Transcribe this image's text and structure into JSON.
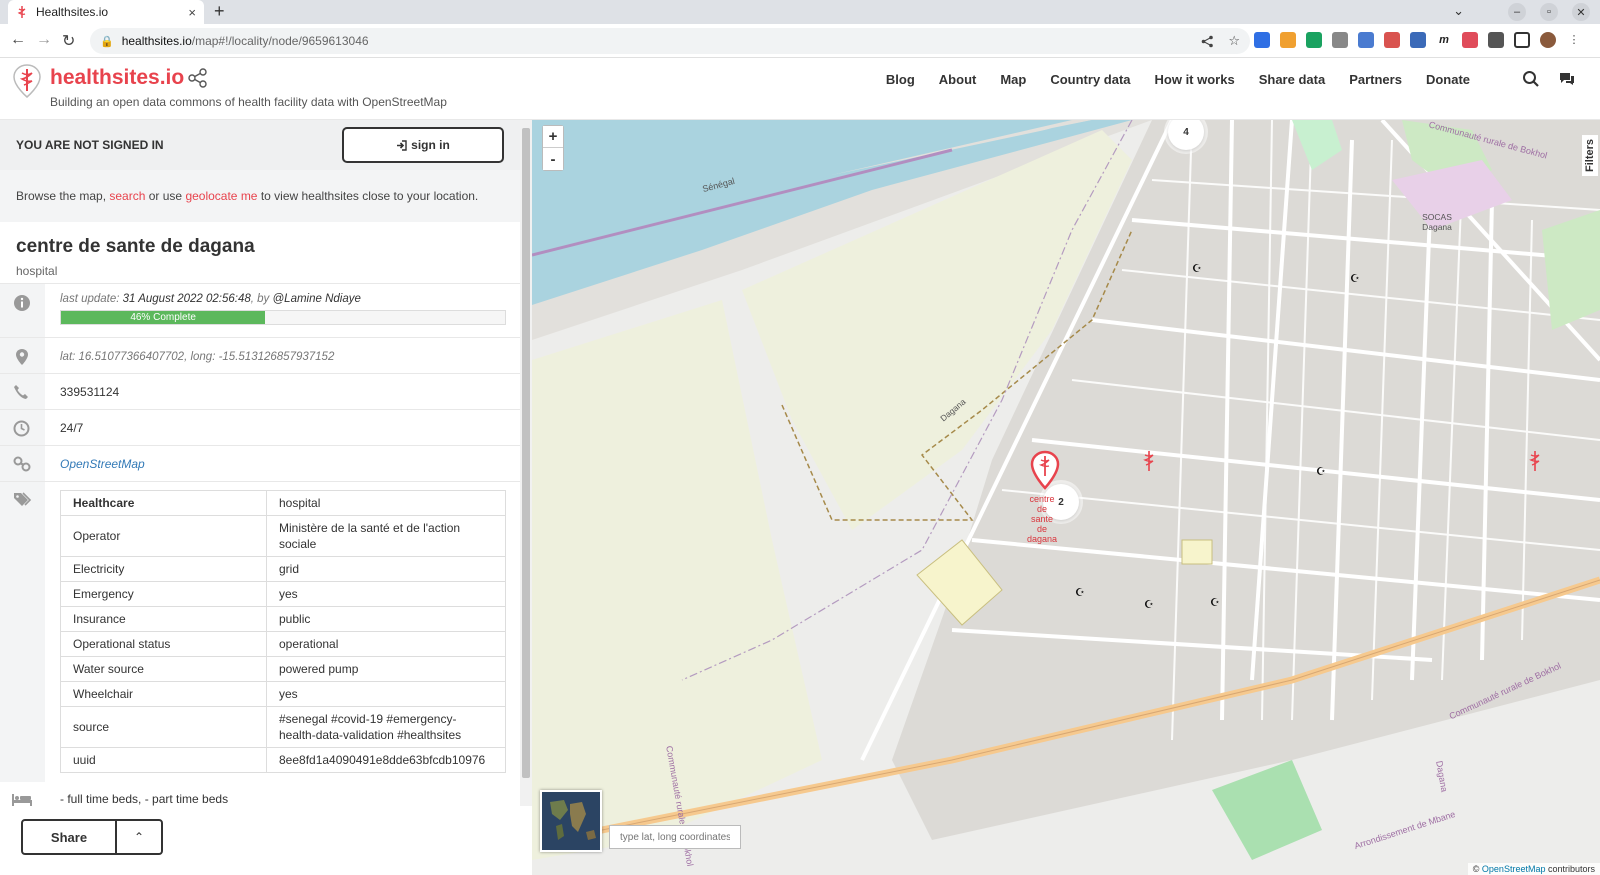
{
  "browser": {
    "tab_title": "Healthsites.io",
    "tab_close": "×",
    "new_tab": "+",
    "url_host": "healthsites.io",
    "url_path": "/map#!/locality/node/9659613046"
  },
  "header": {
    "brand": "healthsites.io",
    "tagline": "Building an open data commons of health facility data with OpenStreetMap",
    "nav": [
      "Blog",
      "About",
      "Map",
      "Country data",
      "How it works",
      "Share data",
      "Partners",
      "Donate"
    ]
  },
  "sidebar": {
    "signin_status": "YOU ARE NOT SIGNED IN",
    "signin_button": "sign in",
    "browse": {
      "before": "Browse the map, ",
      "search_link": "search",
      "middle": " or use ",
      "geolocate_link": "geolocate me",
      "after": " to view healthsites close to your location."
    },
    "facility": {
      "name": "centre de sante de dagana",
      "type": "hospital",
      "last_update_label": "last update: ",
      "last_update_date": "31 August 2022 02:56:48",
      "by_label": ", by ",
      "by_user": "@Lamine Ndiaye",
      "completeness_pct": 46,
      "completeness_label": "46% Complete",
      "coordinates": "lat: 16.51077366407702, long: -15.513126857937152",
      "phone": "339531124",
      "hours": "24/7",
      "source_link": "OpenStreetMap",
      "tags": [
        {
          "key": "Healthcare",
          "value": "hospital"
        },
        {
          "key": "Operator",
          "value": "Ministère de la santé et de l'action sociale"
        },
        {
          "key": "Electricity",
          "value": "grid"
        },
        {
          "key": "Emergency",
          "value": "yes"
        },
        {
          "key": "Insurance",
          "value": "public"
        },
        {
          "key": "Operational status",
          "value": "operational"
        },
        {
          "key": "Water source",
          "value": "powered pump"
        },
        {
          "key": "Wheelchair",
          "value": "yes"
        },
        {
          "key": "source",
          "value": "#senegal #covid-19 #emergency-health-data-validation #healthsites"
        },
        {
          "key": "uuid",
          "value": "8ee8fd1a4090491e8dde63bfcdb10976"
        }
      ],
      "beds": "- full time beds,  - part time beds"
    },
    "share_button": "Share",
    "share_caret": "⌃"
  },
  "map": {
    "zoom_in": "+",
    "zoom_out": "-",
    "filters_label": "Filters",
    "coord_placeholder": "type lat, long coordinates",
    "attribution_prefix": "© ",
    "attribution_link": "OpenStreetMap",
    "attribution_suffix": " contributors",
    "clusters": [
      {
        "count": "4"
      },
      {
        "count": "2"
      }
    ],
    "place_labels": [
      "Communauté rurale de Bokhol",
      "SOCAS Dagana",
      "Dagana",
      "Communauté rurale de Bokhol",
      "Communauté rurale de Bokhol",
      "Arrondissement de Mbane",
      "Dagana",
      "Sénégal"
    ],
    "marker_label": "centre de sante de dagana"
  },
  "colors": {
    "brand": "#e8434d",
    "progress": "#5cb85c",
    "link": "#337ab7"
  }
}
